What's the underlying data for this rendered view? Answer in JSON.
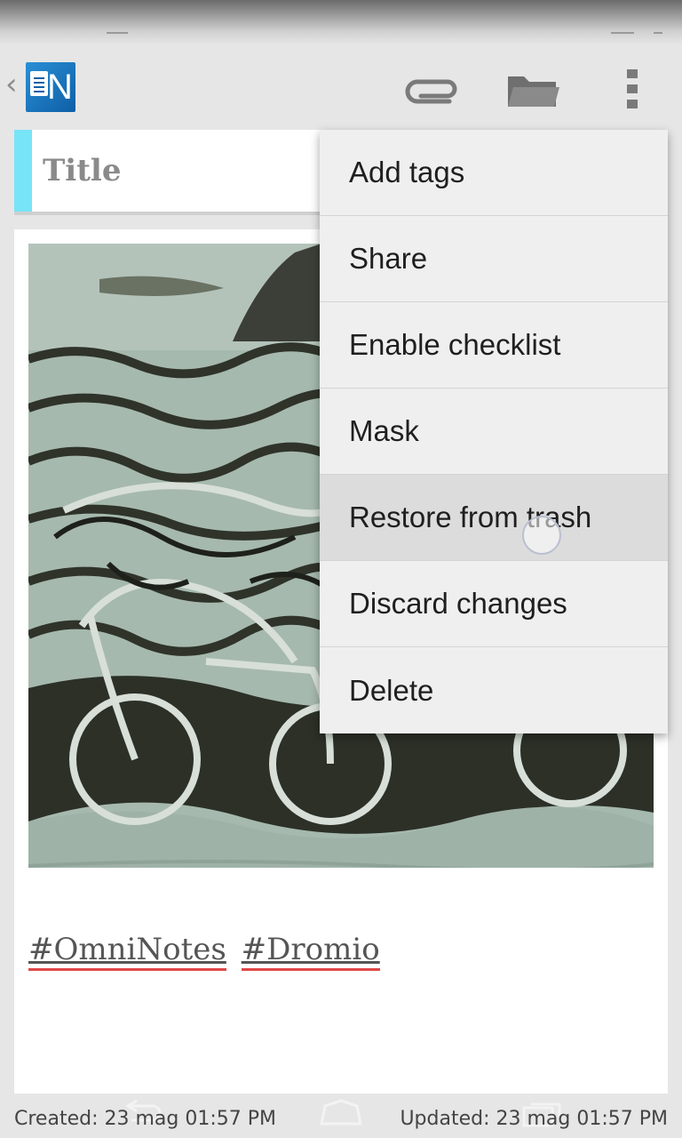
{
  "toolbar": {
    "back_icon": "chevron-left-icon",
    "logo_icon": "omni-notes-logo",
    "logo_letter": "N",
    "attach_icon": "paperclip-icon",
    "folder_icon": "folder-icon",
    "overflow_icon": "more-vert-icon"
  },
  "note": {
    "title_placeholder": "Title",
    "accent_color": "#78e4f7",
    "image_icon": "sketch-photo",
    "tags": [
      "#OmniNotes",
      "#Dromio"
    ]
  },
  "menu": {
    "items": [
      {
        "label": "Add tags"
      },
      {
        "label": "Share"
      },
      {
        "label": "Enable checklist"
      },
      {
        "label": "Mask"
      },
      {
        "label": "Restore from trash"
      },
      {
        "label": "Discard changes"
      },
      {
        "label": "Delete"
      }
    ],
    "pressed_index": 4
  },
  "footer": {
    "created": "Created: 23 mag 01:57 PM",
    "updated": "Updated: 23 mag 01:57 PM"
  },
  "navbar": {
    "back_icon": "nav-back-icon",
    "home_icon": "nav-home-icon",
    "recents_icon": "nav-recents-icon"
  }
}
